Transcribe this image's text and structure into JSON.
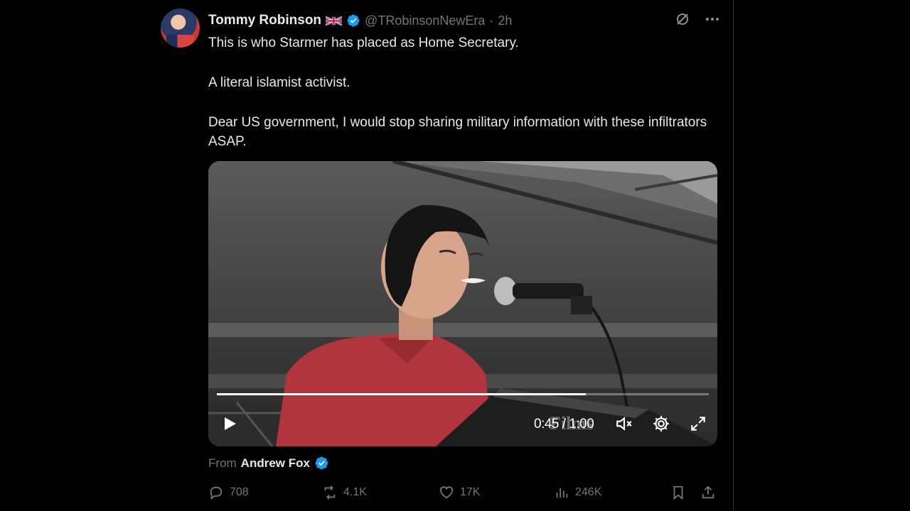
{
  "tweet": {
    "author_name": "Tommy Robinson",
    "handle": "@TRobinsonNewEra",
    "separator": "·",
    "time": "2h",
    "text": [
      "This is who Starmer has placed as Home Secretary.",
      "A literal islamist activist.",
      "Dear US government, I would stop sharing military information with these infiltrators ASAP."
    ]
  },
  "video": {
    "current_time": "0:45",
    "duration": "1:00",
    "time_separator": "/",
    "progress": 0.75,
    "watermark": "Films"
  },
  "source": {
    "prefix": "From",
    "name": "Andrew Fox"
  },
  "actions": {
    "replies": "708",
    "reposts": "4.1K",
    "likes": "17K",
    "views": "246K"
  },
  "colors": {
    "background": "#000000",
    "text": "#e7e9ea",
    "muted": "#71767b",
    "verified": "#1d9bf0"
  }
}
